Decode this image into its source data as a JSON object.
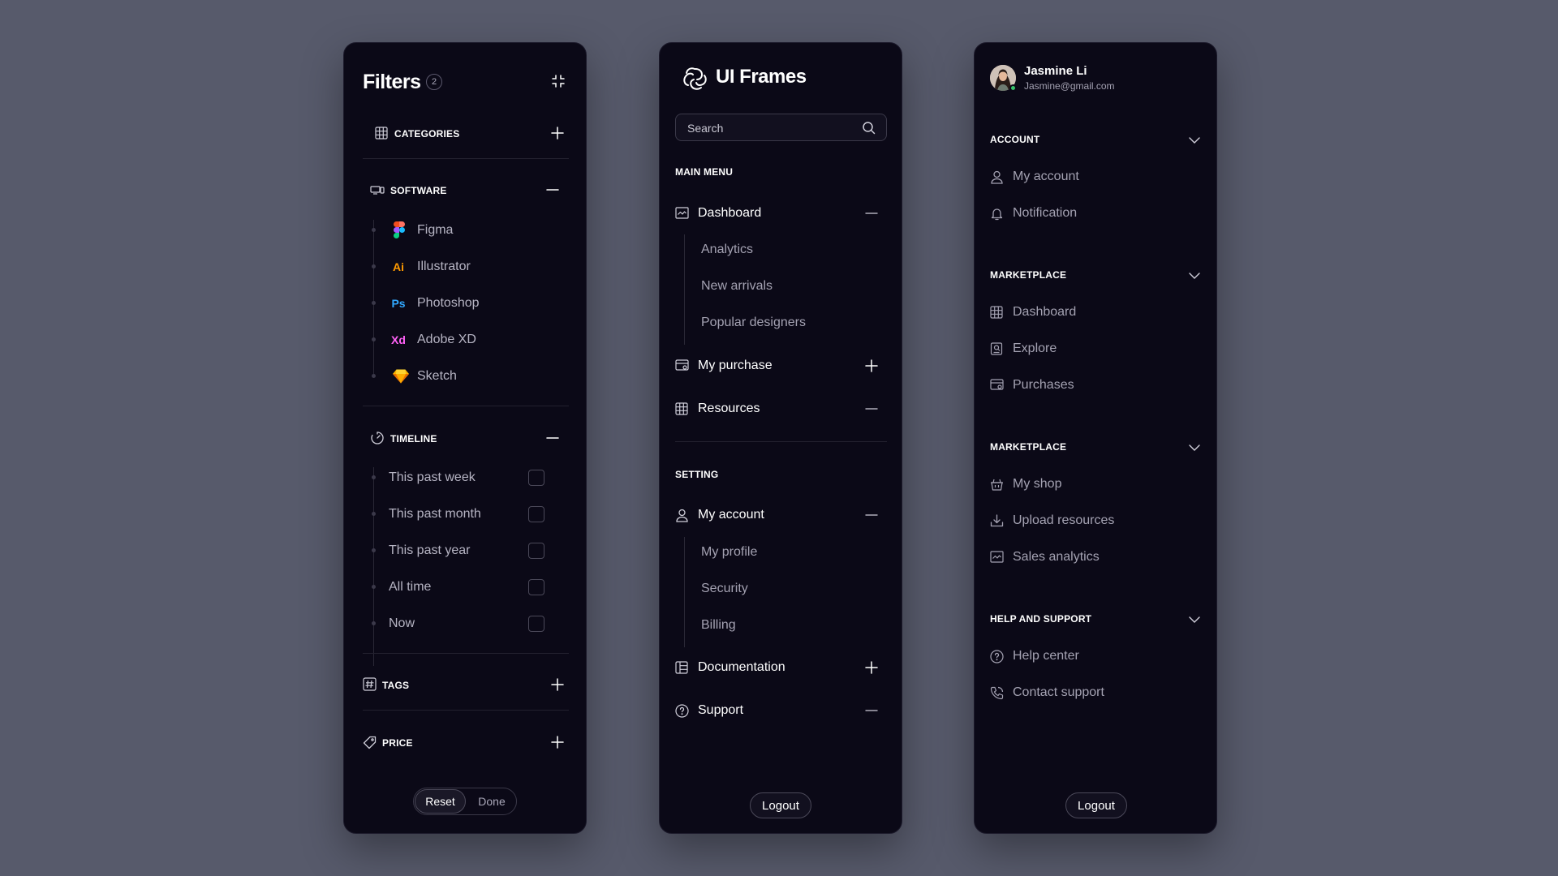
{
  "filters": {
    "title": "Filters",
    "badge": "2",
    "categories_label": "CATEGORIES",
    "software_label": "SOFTWARE",
    "software_items": [
      "Figma",
      "Illustrator",
      "Photoshop",
      "Adobe XD",
      "Sketch"
    ],
    "app_badges": {
      "illustrator": "Ai",
      "photoshop": "Ps",
      "xd": "Xd"
    },
    "timeline_label": "TIMELINE",
    "timeline_items": [
      "This past week",
      "This past month",
      "This past year",
      "All time",
      "Now"
    ],
    "tags_label": "TAGS",
    "price_label": "PRICE",
    "reset_label": "Reset",
    "done_label": "Done"
  },
  "nav": {
    "brand": "UI Frames",
    "search_placeholder": "Search",
    "main_menu_label": "MAIN MENU",
    "dashboard": "Dashboard",
    "dashboard_sub": [
      "Analytics",
      "New arrivals",
      "Popular designers"
    ],
    "my_purchase": "My purchase",
    "resources": "Resources",
    "setting_label": "SETTING",
    "my_account": "My account",
    "account_sub": [
      "My profile",
      "Security",
      "Billing"
    ],
    "documentation": "Documentation",
    "support": "Support",
    "logout": "Logout"
  },
  "profile": {
    "name": "Jasmine Li",
    "email": "Jasmine@gmail.com",
    "account_label": "ACCOUNT",
    "account_items": [
      "My account",
      "Notification"
    ],
    "marketplace_label_1": "MARKETPLACE",
    "marketplace_items_1": [
      "Dashboard",
      "Explore",
      "Purchases"
    ],
    "marketplace_label_2": "MARKETPLACE",
    "marketplace_items_2": [
      "My shop",
      "Upload resources",
      "Sales analytics"
    ],
    "help_label": "HELP AND SUPPORT",
    "help_items": [
      "Help center",
      "Contact support"
    ],
    "logout": "Logout"
  },
  "colors": {
    "background": "#575a6b",
    "panel": "#0b0917",
    "illustrator": "#ff9a00",
    "photoshop": "#31a8ff",
    "xd": "#ff61f6",
    "online": "#36c26b"
  }
}
